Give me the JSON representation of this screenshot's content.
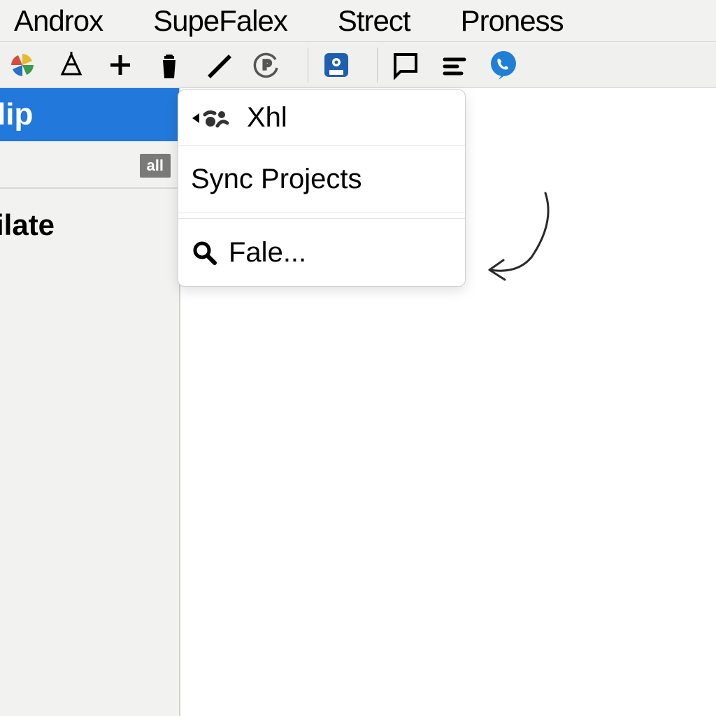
{
  "menubar": {
    "items": [
      "Androx",
      "SupeFalex",
      "Strect",
      "Proness"
    ]
  },
  "toolbar": {
    "icons": [
      "colorful-pinwheel-icon",
      "structure-icon",
      "plus-icon",
      "bucket-icon",
      "pencil-icon",
      "p-revert-icon",
      "disk-icon",
      "chat-icon",
      "align-icon",
      "phone-bubble-icon"
    ]
  },
  "sidebar": {
    "selected_label": "lip",
    "tag_label": "all",
    "item_label": "ilate"
  },
  "dropdown": {
    "row1_label": "Xhl",
    "row2_label": "Sync Projects",
    "row3_label": "Fale..."
  }
}
